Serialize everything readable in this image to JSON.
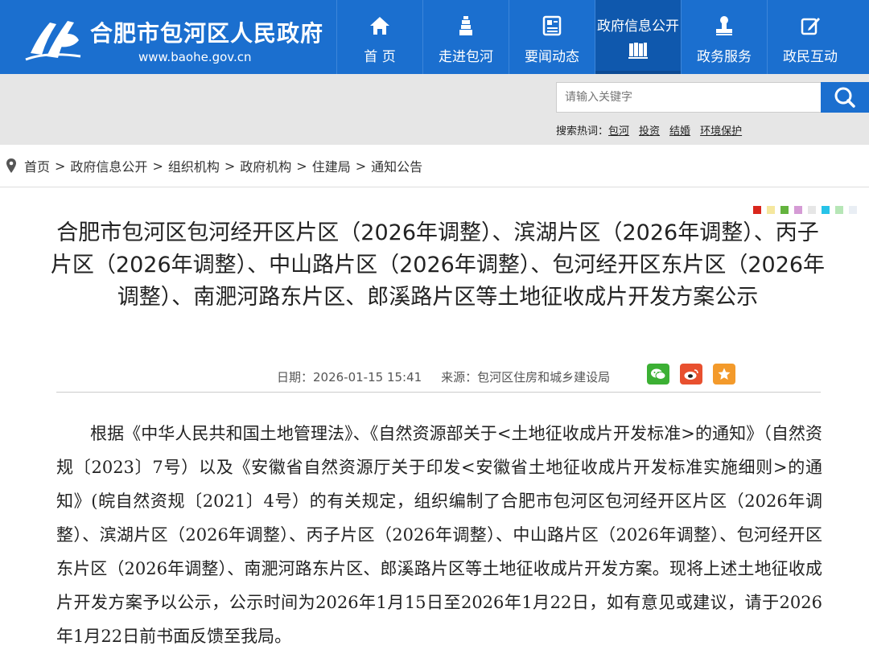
{
  "header": {
    "site_name": "合肥市包河区人民政府",
    "site_url": "www.baohe.gov.cn",
    "logo_icon": "baohe-logo-icon",
    "brand_color": "#1b6fcf"
  },
  "nav": {
    "items": [
      {
        "label": "首 页",
        "icon": "home-icon"
      },
      {
        "label": "走进包河",
        "icon": "tower-icon"
      },
      {
        "label": "要闻动态",
        "icon": "newspaper-icon"
      },
      {
        "label": "政府信息公开",
        "icon": "books-icon",
        "active": true
      },
      {
        "label": "政务服务",
        "icon": "stamp-icon"
      },
      {
        "label": "政民互动",
        "icon": "edit-icon"
      }
    ]
  },
  "search": {
    "placeholder": "请输入关键字",
    "hot_label": "搜索热词：",
    "hot_words": [
      "包河",
      "投资",
      "结婚",
      "环境保护"
    ]
  },
  "breadcrumb": {
    "items": [
      "首页",
      "政府信息公开",
      "组织机构",
      "政府机构",
      "住建局",
      "通知公告"
    ],
    "separator": ">"
  },
  "swatches": [
    "#d9261c",
    "#f5e79e",
    "#64b33e",
    "#d59bd5",
    "#e6e6e6",
    "#27c3e8",
    "#b6e6b6",
    "#e9eef4"
  ],
  "article": {
    "title": "合肥市包河区包河经开区片区（2026年调整）、滨湖片区（2026年调整）、丙子片区（2026年调整）、中山路片区（2026年调整）、包河经开区东片区（2026年调整）、南淝河路东片区、郎溪路片区等土地征收成片开发方案公示",
    "date": "日期：2026-01-15 15:41",
    "source": "来源：包河区住房和城乡建设局",
    "share": [
      "wechat-icon",
      "weibo-icon",
      "favorite-icon"
    ],
    "body": "根据《中华人民共和国土地管理法》、《自然资源部关于<土地征收成片开发标准>的通知》（自然资规〔2023〕7号）以及《安徽省自然资源厅关于印发<安徽省土地征收成片开发标准实施细则>的通知》(皖自然资规〔2021〕4号）的有关规定，组织编制了合肥市包河区包河经开区片区（2026年调整）、滨湖片区（2026年调整）、丙子片区（2026年调整）、中山路片区（2026年调整）、包河经开区东片区（2026年调整）、南淝河路东片区、郎溪路片区等土地征收成片开发方案。现将上述土地征收成片开发方案予以公示，公示时间为2026年1月15日至2026年1月22日，如有意见或建议，请于2026年1月22日前书面反馈至我局。"
  }
}
